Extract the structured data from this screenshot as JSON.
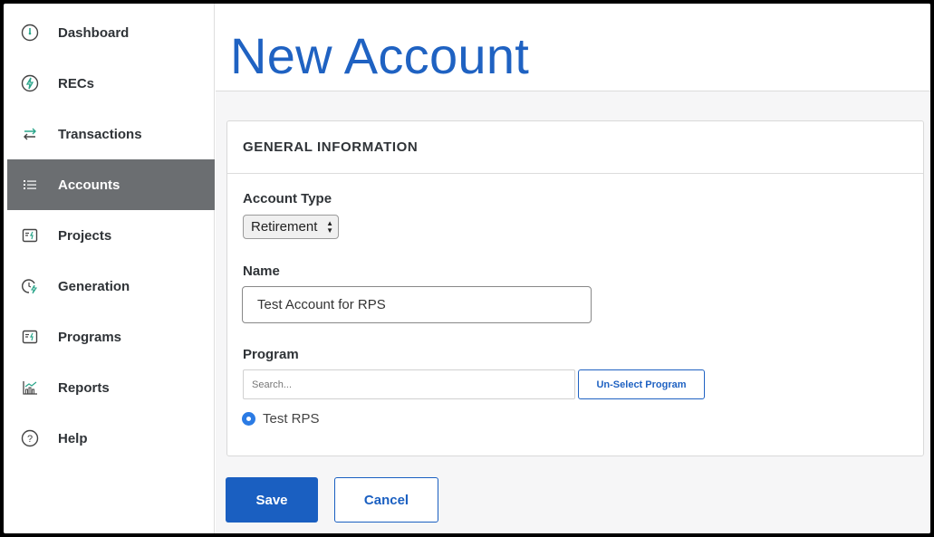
{
  "sidebar": {
    "items": [
      {
        "label": "Dashboard",
        "icon": "dashboard-gauge-icon"
      },
      {
        "label": "RECs",
        "icon": "lightning-circle-icon"
      },
      {
        "label": "Transactions",
        "icon": "swap-arrows-icon"
      },
      {
        "label": "Accounts",
        "icon": "list-icon",
        "active": true
      },
      {
        "label": "Projects",
        "icon": "project-card-icon"
      },
      {
        "label": "Generation",
        "icon": "clock-lightning-icon"
      },
      {
        "label": "Programs",
        "icon": "program-card-icon"
      },
      {
        "label": "Reports",
        "icon": "bar-chart-icon"
      },
      {
        "label": "Help",
        "icon": "question-circle-icon"
      }
    ]
  },
  "page": {
    "title": "New Account"
  },
  "form": {
    "section_title": "GENERAL INFORMATION",
    "account_type_label": "Account Type",
    "account_type_value": "Retirement",
    "name_label": "Name",
    "name_value": "Test Account for RPS",
    "program_label": "Program",
    "search_placeholder": "Search...",
    "unselect_label": "Un-Select Program",
    "selected_program": "Test RPS"
  },
  "actions": {
    "save_label": "Save",
    "cancel_label": "Cancel"
  },
  "colors": {
    "accent": "#1f62c2",
    "sidebar_active": "#6b6e71",
    "icon_teal": "#2aa58a",
    "radio": "#2b7be4"
  }
}
